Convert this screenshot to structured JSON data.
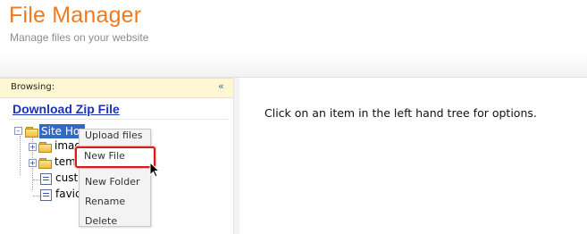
{
  "header": {
    "title": "File Manager",
    "subtitle": "Manage files on your website"
  },
  "sidebar": {
    "browsing_label": "Browsing:",
    "collapse_icon": "double-chevron-left-icon",
    "download_link": "Download Zip File",
    "tree": {
      "root": {
        "label": "Site Ho",
        "selected": true,
        "expanded": true
      },
      "children": [
        {
          "label": "imag",
          "type": "folder",
          "expanded": false
        },
        {
          "label": "tem",
          "type": "folder",
          "expanded": false
        },
        {
          "label": "cust",
          "type": "file"
        },
        {
          "label": "favic",
          "type": "file"
        }
      ]
    }
  },
  "context_menu": {
    "items": [
      "Upload files",
      "New File",
      "New Folder",
      "Rename",
      "Delete"
    ],
    "highlighted": "New File"
  },
  "main": {
    "message": "Click on an item in the left hand tree for options."
  },
  "colors": {
    "title": "#f27a1c",
    "link": "#1c33b8",
    "selection": "#3169c6",
    "highlight_border": "#d81c1c",
    "browse_bar": "#fdf8d2"
  }
}
